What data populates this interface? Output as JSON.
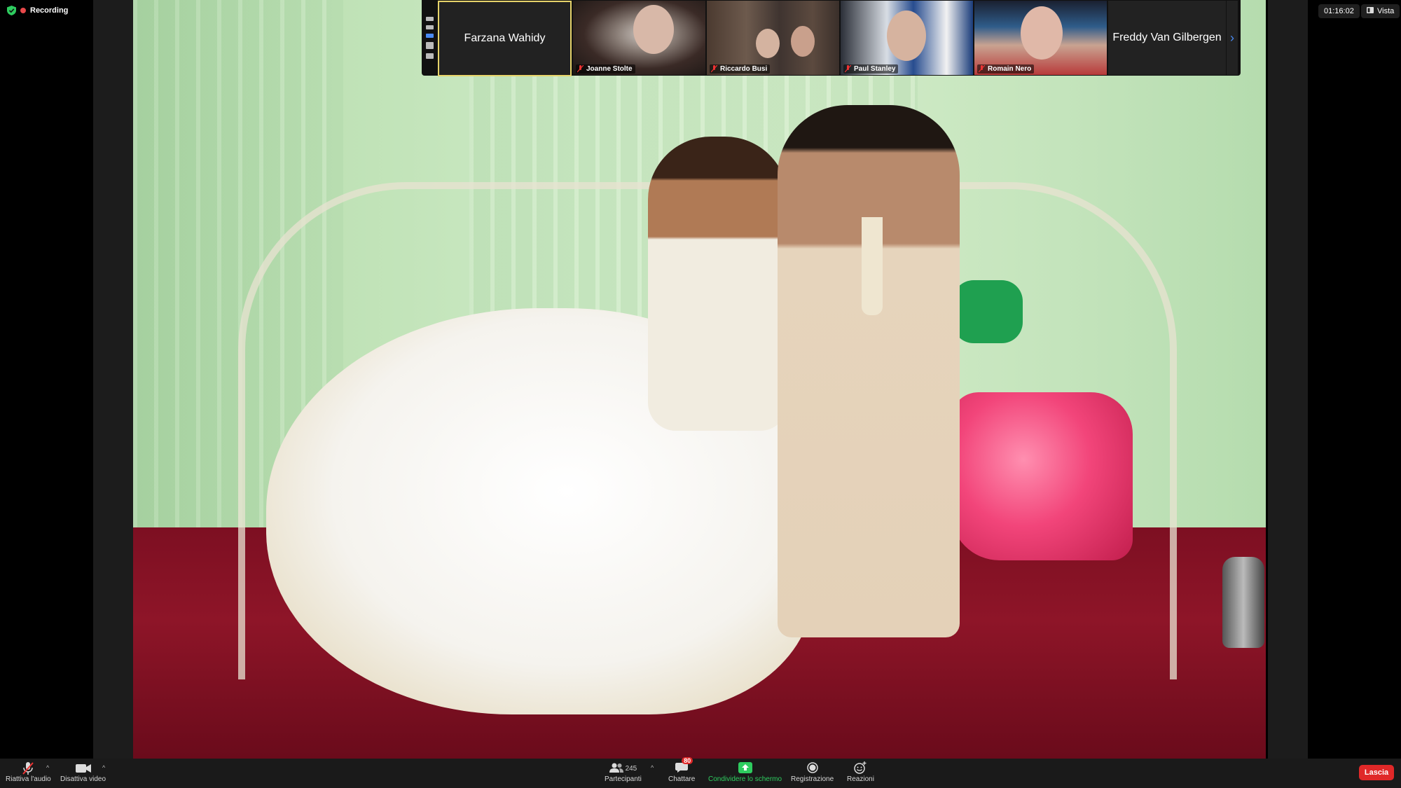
{
  "status": {
    "recording_label": "Recording"
  },
  "top_right": {
    "timer": "01:16:02",
    "view_label": "Vista"
  },
  "gallery": {
    "speaker_name": "Farzana Wahidy",
    "tiles": [
      {
        "name": "Joanne Stolte"
      },
      {
        "name": "Riccardo Busi"
      },
      {
        "name": "Paul Stanley"
      },
      {
        "name": "Romain Nero"
      }
    ],
    "last_tile_name": "Freddy Van Gilbergen"
  },
  "toolbar": {
    "audio_label": "Riattiva l'audio",
    "video_label": "Disattiva video",
    "participants_label": "Partecipanti",
    "participants_count": "245",
    "chat_label": "Chattare",
    "chat_badge": "80",
    "share_label": "Condividere lo schermo",
    "record_label": "Registrazione",
    "reactions_label": "Reazioni",
    "leave_label": "Lascia"
  },
  "colors": {
    "accent_green": "#2ecc5f",
    "leave_red": "#e02828",
    "active_speaker": "#e6d36a",
    "link_blue": "#4a8bf5"
  }
}
